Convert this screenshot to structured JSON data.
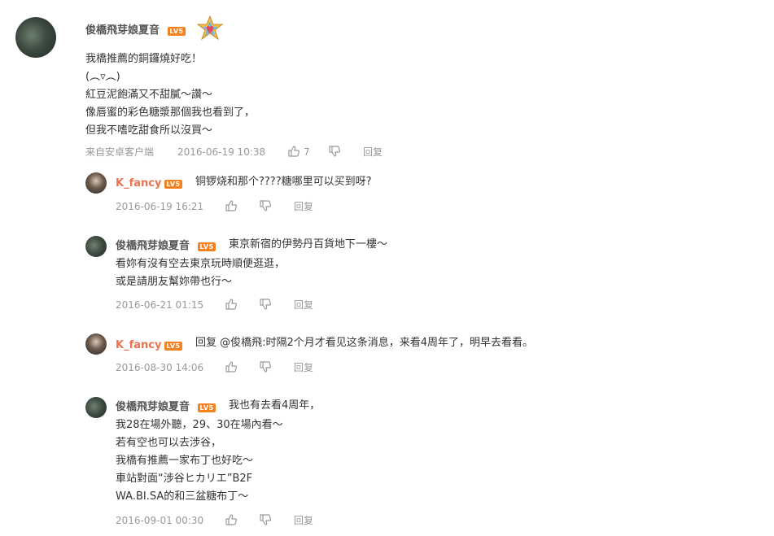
{
  "main_comment": {
    "username": "俊橋飛芽娘夏音",
    "level": "LV5",
    "lines": [
      "我橋推薦的銅鑼燒好吃！",
      "(︵▿︵)",
      "紅豆泥飽滿又不甜膩～讚～",
      "像唇蜜的彩色糖漿那個我也看到了，",
      "但我不嗜吃甜食所以沒買～"
    ],
    "source": "来自安卓客户端",
    "timestamp": "2016-06-19 10:38",
    "like_count": "7",
    "reply_label": "回复"
  },
  "replies": [
    {
      "username": "K_fancy",
      "level": "LV5",
      "lines": [
        "铜锣烧和那个????糖哪里可以买到呀?"
      ],
      "timestamp": "2016-06-19 16:21",
      "reply_label": "回复"
    },
    {
      "username": "俊橋飛芽娘夏音",
      "level": "LV5",
      "lines": [
        "東京新宿的伊勢丹百貨地下一樓～",
        "看妳有沒有空去東京玩時順便逛逛，",
        "或是請朋友幫妳帶也行～"
      ],
      "timestamp": "2016-06-21 01:15",
      "reply_label": "回复"
    },
    {
      "username": "K_fancy",
      "level": "LV5",
      "lines": [
        "回复 @俊橋飛:时隔2个月才看见这条消息，来看4周年了，明早去看看。"
      ],
      "timestamp": "2016-08-30 14:06",
      "reply_label": "回复"
    },
    {
      "username": "俊橋飛芽娘夏音",
      "level": "LV5",
      "lines": [
        "我也有去看4周年，",
        "我28在場外聽，29、30在場內看～",
        "若有空也可以去涉谷，",
        "我橋有推薦一家布丁也好吃～",
        "車站對面“涉谷ヒカリエ”B2F",
        "WA.BI.SA的和三盆糖布丁～"
      ],
      "timestamp": "2016-09-01 00:30",
      "reply_label": "回复"
    }
  ],
  "colors": {
    "accent_name": "#eb7350",
    "level_badge": "#f5821f",
    "meta_text": "#999999"
  },
  "icons": {
    "badge": "star-medal-icon",
    "like": "thumbs-up-icon",
    "dislike": "thumbs-down-icon"
  }
}
